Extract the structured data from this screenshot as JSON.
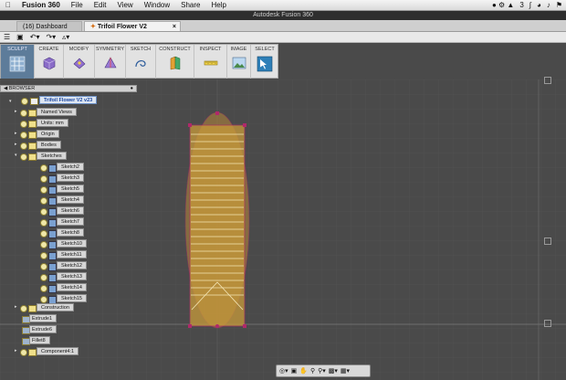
{
  "menubar": {
    "app": "Fusion 360",
    "items": [
      "File",
      "Edit",
      "View",
      "Window",
      "Share",
      "Help"
    ],
    "status_badge": "3"
  },
  "window": {
    "title": "Autodesk Fusion 360"
  },
  "tabs": [
    {
      "label": "(16) Dashboard",
      "active": false
    },
    {
      "label": "Trifoil Flower V2",
      "active": true
    }
  ],
  "ribbon": {
    "workspace": "SCULPT",
    "groups": [
      "CREATE",
      "MODIFY",
      "SYMMETRY",
      "SKETCH",
      "CONSTRUCT",
      "INSPECT",
      "IMAGE",
      "SELECT"
    ]
  },
  "browser": {
    "header": "BROWSER",
    "root": "Trifoil Flower V2 v23",
    "items": [
      {
        "label": "Named Views",
        "icon": "folder"
      },
      {
        "label": "Units: mm",
        "icon": "doc"
      },
      {
        "label": "Origin",
        "icon": "folder"
      },
      {
        "label": "Bodies",
        "icon": "folder"
      },
      {
        "label": "Sketches",
        "icon": "folder"
      },
      {
        "label": "Sketch2",
        "icon": "sketch"
      },
      {
        "label": "Sketch3",
        "icon": "sketch"
      },
      {
        "label": "Sketch5",
        "icon": "sketch"
      },
      {
        "label": "Sketch4",
        "icon": "sketch"
      },
      {
        "label": "Sketch6",
        "icon": "sketch"
      },
      {
        "label": "Sketch7",
        "icon": "sketch"
      },
      {
        "label": "Sketch8",
        "icon": "sketch"
      },
      {
        "label": "Sketch10",
        "icon": "sketch"
      },
      {
        "label": "Sketch11",
        "icon": "sketch"
      },
      {
        "label": "Sketch12",
        "icon": "sketch"
      },
      {
        "label": "Sketch13",
        "icon": "sketch"
      },
      {
        "label": "Sketch14",
        "icon": "sketch"
      },
      {
        "label": "Sketch15",
        "icon": "sketch"
      },
      {
        "label": "Construction",
        "icon": "folder"
      },
      {
        "label": "Extrude1",
        "icon": "feature"
      },
      {
        "label": "Extrude6",
        "icon": "feature"
      },
      {
        "label": "Fillet8",
        "icon": "feature"
      },
      {
        "label": "Component4:1",
        "icon": "component"
      }
    ]
  },
  "colors": {
    "canvas": "#4a4a4a",
    "sketch_fill": "#c89a3a",
    "sketch_edge": "#b0286a",
    "selection_blue": "#1a45a0"
  }
}
